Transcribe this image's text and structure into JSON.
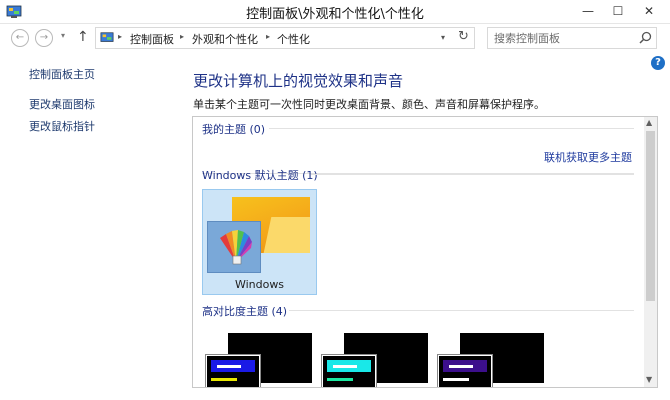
{
  "window": {
    "title": "控制面板\\外观和个性化\\个性化",
    "minimize": "—",
    "maximize": "☐",
    "close": "✕"
  },
  "nav": {
    "back": "←",
    "forward": "→",
    "recent": "▾",
    "up": "↑",
    "breadcrumb": [
      "控制面板",
      "外观和个性化",
      "个性化"
    ],
    "separator": "▸",
    "dropdown": "▾",
    "refresh": "↻",
    "search_placeholder": "搜索控制面板"
  },
  "help": "?",
  "sidebar": {
    "items": [
      "控制面板主页",
      "更改桌面图标",
      "更改鼠标指针"
    ]
  },
  "main": {
    "title": "更改计算机上的视觉效果和声音",
    "description": "单击某个主题可一次性同时更改桌面背景、颜色、声音和屏幕保护程序。",
    "my_themes": "我的主题 (0)",
    "get_more": "联机获取更多主题",
    "default_themes": "Windows 默认主题 (1)",
    "windows_theme": "Windows",
    "high_contrast": "高对比度主题 (4)",
    "high_contrast_accents": [
      "#1a1ae6",
      "#19e8e8",
      "#3c0f8c"
    ],
    "high_contrast_bars": [
      "#e8e800",
      "#19e8a0",
      "#ffffff"
    ]
  },
  "colors": {
    "link": "#1e3287",
    "selected_tile": "#cce4f7",
    "help": "#1e6fc6"
  }
}
